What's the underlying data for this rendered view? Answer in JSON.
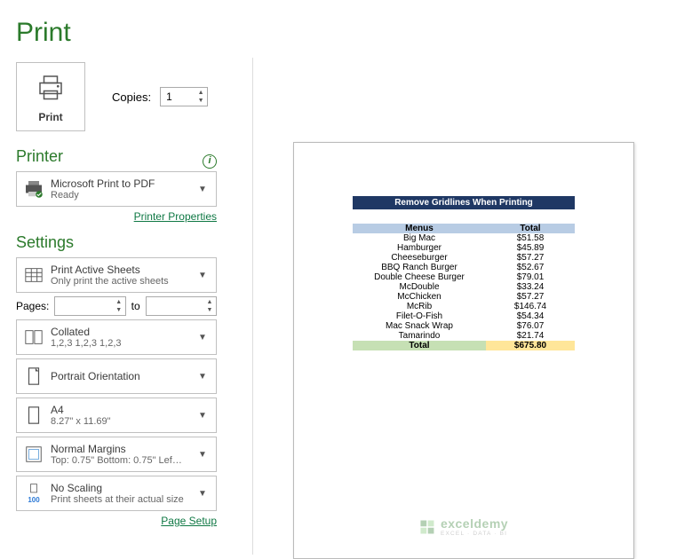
{
  "page_title": "Print",
  "copies": {
    "label": "Copies:",
    "value": "1"
  },
  "print_button_label": "Print",
  "printer_section": "Printer",
  "printer": {
    "name": "Microsoft Print to PDF",
    "status": "Ready"
  },
  "printer_properties_link": "Printer Properties",
  "settings_section": "Settings",
  "settings": {
    "sheets": {
      "line1": "Print Active Sheets",
      "line2": "Only print the active sheets"
    },
    "pages_label": "Pages:",
    "pages_to": "to",
    "collated": {
      "line1": "Collated",
      "line2": "1,2,3    1,2,3    1,2,3"
    },
    "orientation": {
      "line1": "Portrait Orientation"
    },
    "paper": {
      "line1": "A4",
      "line2": "8.27\" x 11.69\""
    },
    "margins": {
      "line1": "Normal Margins",
      "line2": "Top: 0.75\" Bottom: 0.75\" Lef…"
    },
    "scaling": {
      "line1": "No Scaling",
      "line2": "Print sheets at their actual size",
      "badge": "100"
    }
  },
  "page_setup_link": "Page Setup",
  "preview": {
    "title": "Remove Gridlines When Printing",
    "headers": [
      "Menus",
      "Total"
    ],
    "rows": [
      [
        "Big Mac",
        "$51.58"
      ],
      [
        "Hamburger",
        "$45.89"
      ],
      [
        "Cheeseburger",
        "$57.27"
      ],
      [
        "BBQ Ranch Burger",
        "$52.67"
      ],
      [
        "Double Cheese Burger",
        "$79.01"
      ],
      [
        "McDouble",
        "$33.24"
      ],
      [
        "McChicken",
        "$57.27"
      ],
      [
        "McRib",
        "$146.74"
      ],
      [
        "Filet-O-Fish",
        "$54.34"
      ],
      [
        "Mac Snack Wrap",
        "$76.07"
      ],
      [
        "Tamarindo",
        "$21.74"
      ]
    ],
    "total": [
      "Total",
      "$675.80"
    ]
  },
  "watermark": {
    "brand": "exceldemy",
    "tagline": "EXCEL · DATA · BI"
  }
}
